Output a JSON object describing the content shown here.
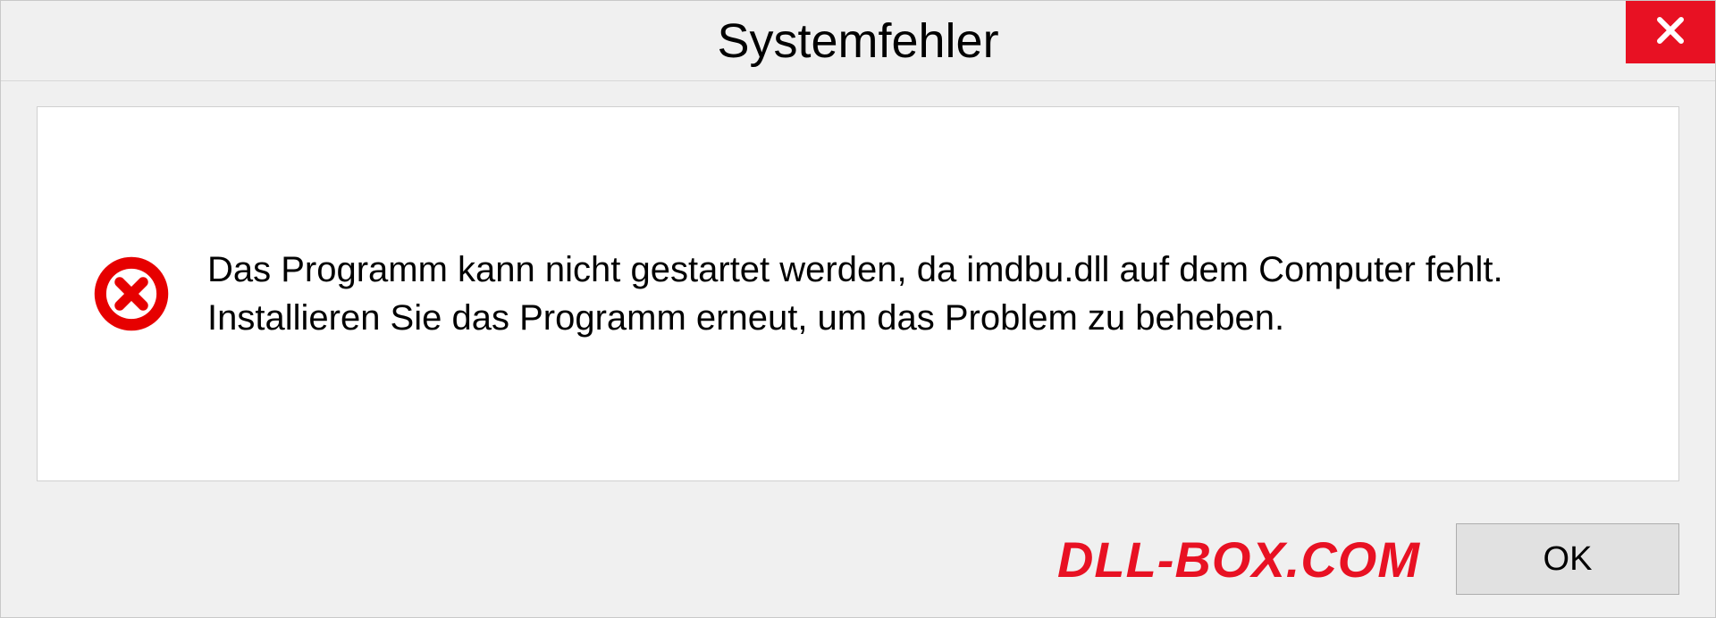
{
  "dialog": {
    "title": "Systemfehler",
    "message": "Das Programm kann nicht gestartet werden, da imdbu.dll auf dem Computer fehlt. Installieren Sie das Programm erneut, um das Problem zu beheben.",
    "ok_label": "OK",
    "watermark": "DLL-BOX.COM"
  },
  "colors": {
    "close_bg": "#e81123",
    "error_red": "#e60000",
    "watermark": "#e81123"
  }
}
